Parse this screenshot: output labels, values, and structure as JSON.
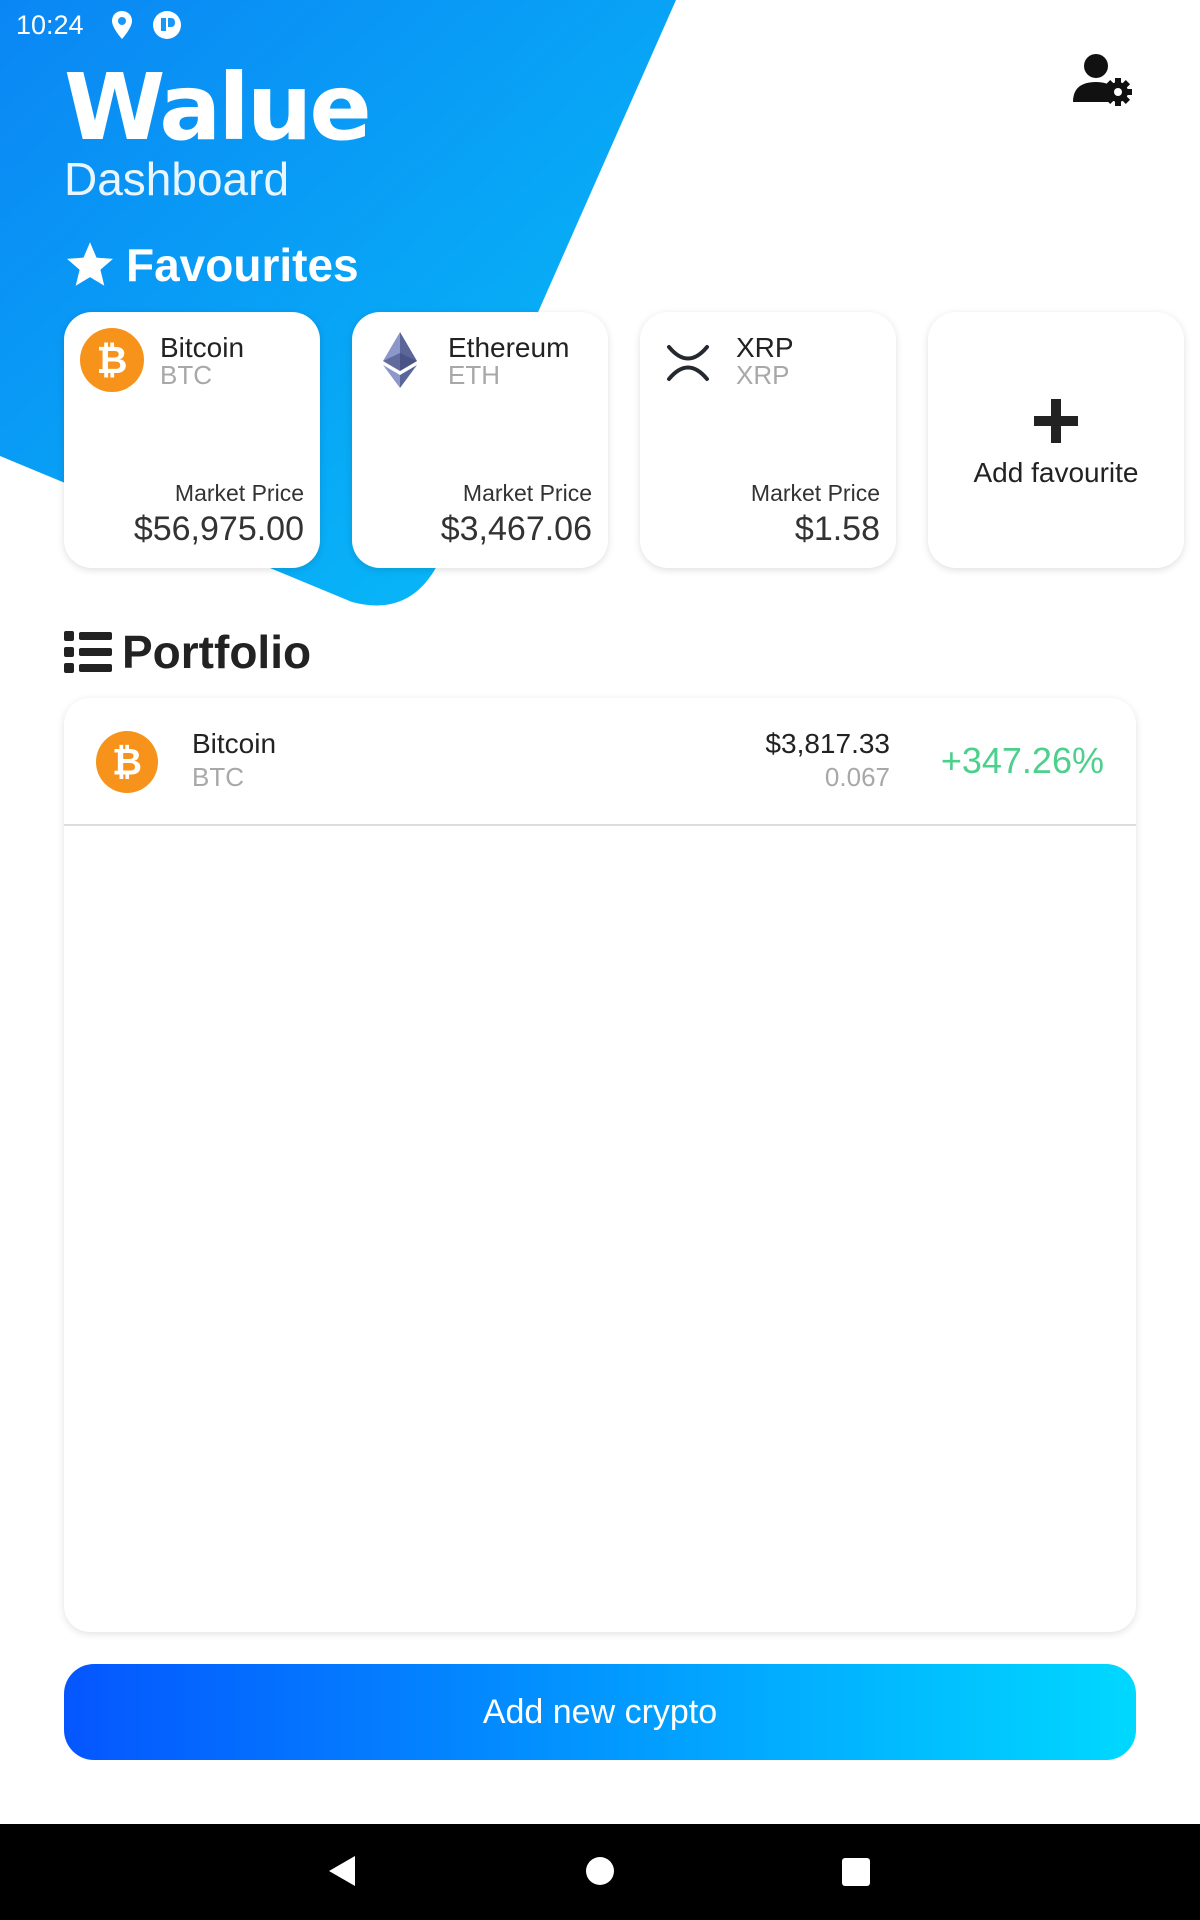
{
  "status_bar": {
    "time": "10:24",
    "icons": [
      "location-icon",
      "app-notification-icon"
    ]
  },
  "header": {
    "brand": "Walue",
    "subtitle": "Dashboard",
    "profile_icon": "user-settings-icon"
  },
  "favourites": {
    "title": "Favourites",
    "title_icon": "star-icon",
    "market_price_label": "Market Price",
    "cards": [
      {
        "name": "Bitcoin",
        "symbol": "BTC",
        "price": "$56,975.00",
        "icon": "bitcoin-icon"
      },
      {
        "name": "Ethereum",
        "symbol": "ETH",
        "price": "$3,467.06",
        "icon": "ethereum-icon"
      },
      {
        "name": "XRP",
        "symbol": "XRP",
        "price": "$1.58",
        "icon": "xrp-icon"
      }
    ],
    "add_label": "Add favourite"
  },
  "portfolio": {
    "title": "Portfolio",
    "title_icon": "list-icon",
    "items": [
      {
        "name": "Bitcoin",
        "symbol": "BTC",
        "value": "$3,817.33",
        "amount": "0.067",
        "change": "+347.26%",
        "icon": "bitcoin-icon"
      }
    ]
  },
  "actions": {
    "add_crypto": "Add new crypto"
  },
  "nav_bar": {
    "icons": [
      "back-icon",
      "home-icon",
      "recents-icon"
    ]
  },
  "colors": {
    "header_gradient_start": "#0b8cf5",
    "header_gradient_end": "#07b6f7",
    "button_gradient_start": "#0556ff",
    "button_gradient_end": "#00d8ff",
    "positive_change": "#4cd08c",
    "bitcoin_orange": "#f7931a",
    "ethereum_purple": "#627eea"
  }
}
